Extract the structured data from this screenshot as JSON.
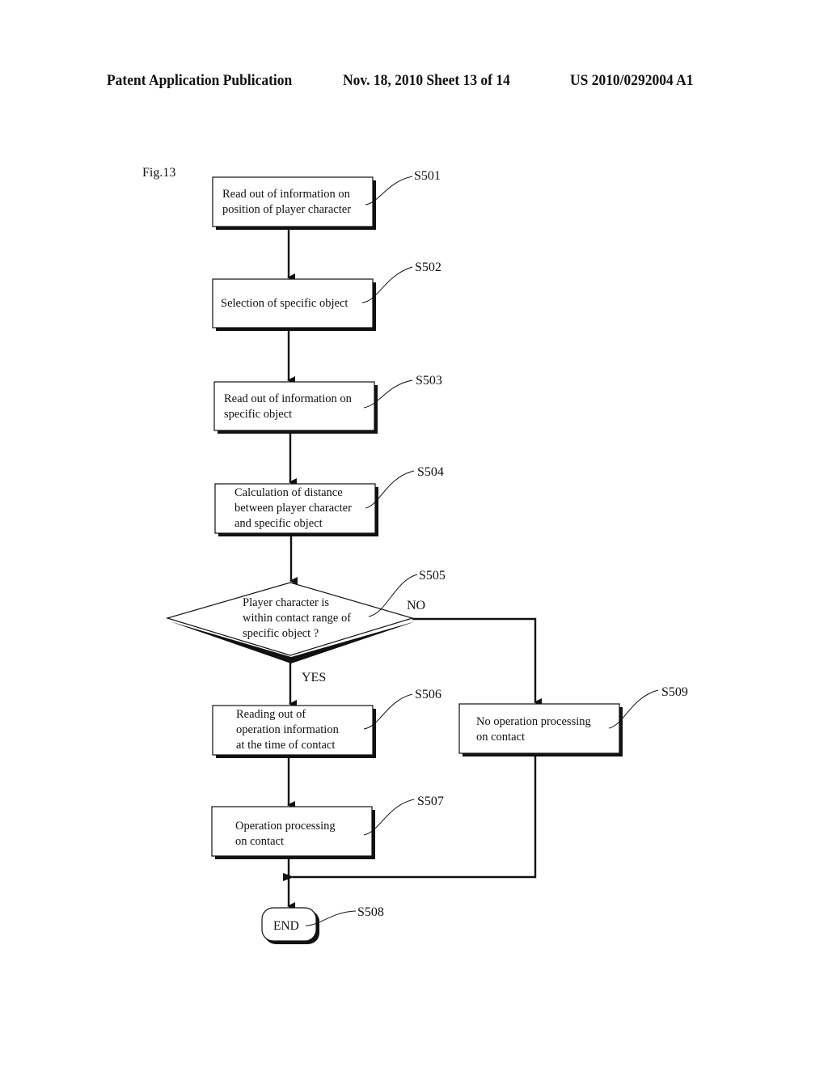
{
  "header": {
    "publication": "Patent Application Publication",
    "date_sheet": "Nov. 18, 2010   Sheet 13 of 14",
    "number": "US 2010/0292004 A1"
  },
  "figure_label": "Fig.13",
  "steps": [
    {
      "id": "S501",
      "lines": [
        "Read out of information on",
        "position of player character"
      ]
    },
    {
      "id": "S502",
      "lines": [
        "Selection of  specific object"
      ]
    },
    {
      "id": "S503",
      "lines": [
        "Read out of information on",
        "specific object"
      ]
    },
    {
      "id": "S504",
      "lines": [
        "Calculation of distance",
        "between player character",
        "and specific object"
      ]
    },
    {
      "id": "S505",
      "lines": [
        "Player character is",
        "within contact range of",
        "specific object ?"
      ]
    },
    {
      "id": "S506",
      "lines": [
        "Reading out of",
        "operation information",
        "at the time of contact"
      ]
    },
    {
      "id": "S507",
      "lines": [
        "Operation processing",
        "on contact"
      ]
    },
    {
      "id": "S508",
      "lines": [
        "END"
      ]
    },
    {
      "id": "S509",
      "lines": [
        "No operation processing",
        "on contact"
      ]
    }
  ],
  "branches": {
    "yes": "YES",
    "no": "NO"
  }
}
